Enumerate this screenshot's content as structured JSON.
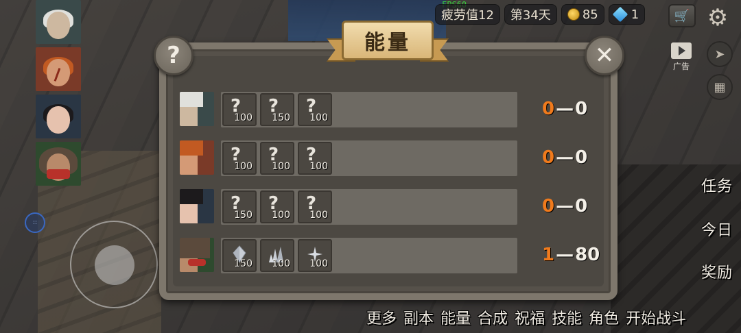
{
  "hud": {
    "fps": "FPS60",
    "fatigue": "疲劳值12",
    "day": "第34天",
    "gold": "85",
    "gems": "1",
    "ad_label": "广告"
  },
  "dialog": {
    "title": "能量",
    "help_label": "?",
    "close_label": "✕",
    "rows": [
      {
        "hero": "elder",
        "slots": [
          {
            "icon": "?",
            "cost": "100"
          },
          {
            "icon": "?",
            "cost": "150"
          },
          {
            "icon": "?",
            "cost": "100"
          }
        ],
        "level": "0",
        "energy": "0"
      },
      {
        "hero": "redhead",
        "slots": [
          {
            "icon": "?",
            "cost": "100"
          },
          {
            "icon": "?",
            "cost": "100"
          },
          {
            "icon": "?",
            "cost": "100"
          }
        ],
        "level": "0",
        "energy": "0"
      },
      {
        "hero": "girl",
        "slots": [
          {
            "icon": "?",
            "cost": "150"
          },
          {
            "icon": "?",
            "cost": "100"
          },
          {
            "icon": "?",
            "cost": "100"
          }
        ],
        "level": "0",
        "energy": "0"
      },
      {
        "hero": "hooded",
        "slots": [
          {
            "icon": "crystal",
            "cost": "150"
          },
          {
            "icon": "crystal",
            "cost": "100"
          },
          {
            "icon": "crystal",
            "cost": "100"
          }
        ],
        "level": "1",
        "energy": "80"
      }
    ]
  },
  "side_menu": {
    "task": "任务",
    "today": "今日",
    "reward": "奖励"
  },
  "bottom_menu": [
    "更多",
    "副本",
    "能量",
    "合成",
    "祝福",
    "技能",
    "角色",
    "开始战斗"
  ],
  "colors": {
    "accent_orange": "#f07a1c",
    "panel": "#56514a",
    "banner": "#e6c990"
  }
}
